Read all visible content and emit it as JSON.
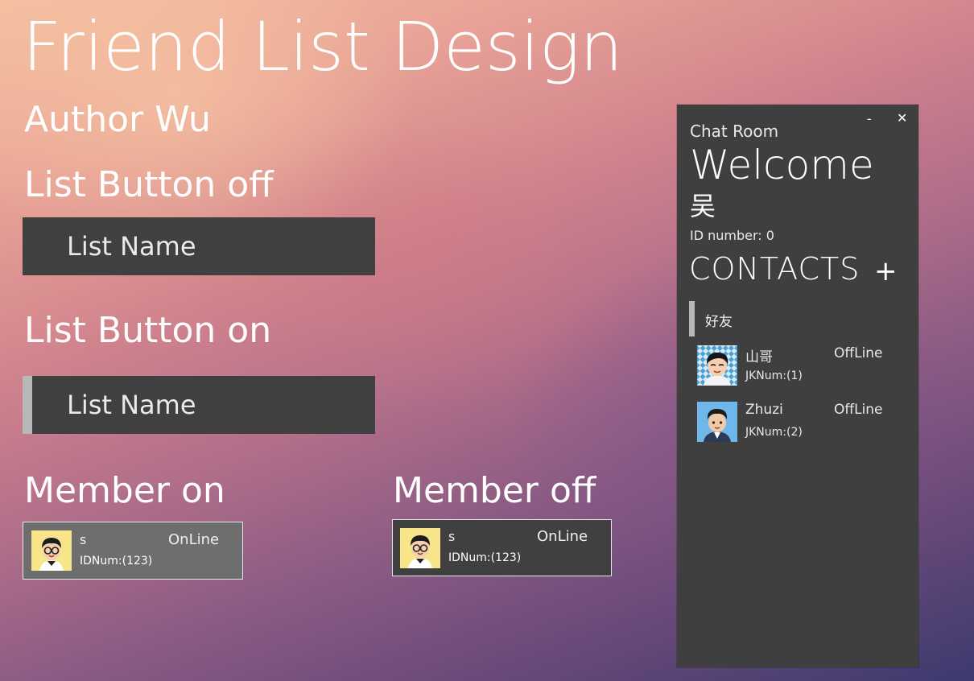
{
  "page": {
    "title": "Friend List Design",
    "author": "Author Wu"
  },
  "list_button_off": {
    "section_label": "List Button off",
    "label": "List Name"
  },
  "list_button_on": {
    "section_label": "List Button on",
    "label": "List Name"
  },
  "member_on": {
    "section_label": "Member on",
    "name": "s",
    "status": "OnLine",
    "id_text": "IDNum:(123)",
    "avatar_icon": "avatar-glasses-icon"
  },
  "member_off": {
    "section_label": "Member off",
    "name": "s",
    "status": "OnLine",
    "id_text": "IDNum:(123)",
    "avatar_icon": "avatar-glasses-icon"
  },
  "chat_panel": {
    "minimize_glyph": "-",
    "close_glyph": "✕",
    "subtitle": "Chat Room",
    "welcome": "Welcome",
    "user_name": "吴",
    "id_text": "ID number: 0",
    "contacts_header": "CONTACTS",
    "add_glyph": "+",
    "group_label": "好友",
    "contacts": [
      {
        "name": "山哥",
        "status": "OffLine",
        "id_text": "JKNum:(1)",
        "avatar_icon": "avatar-checkered-icon"
      },
      {
        "name": "Zhuzi",
        "status": "OffLine",
        "id_text": "JKNum:(2)",
        "avatar_icon": "avatar-blue-icon"
      }
    ]
  },
  "colors": {
    "panel_bg": "#3f3f3f",
    "button_bg": "#404040",
    "member_on_bg": "#6e6e6e",
    "marker": "#b8b8b8"
  }
}
